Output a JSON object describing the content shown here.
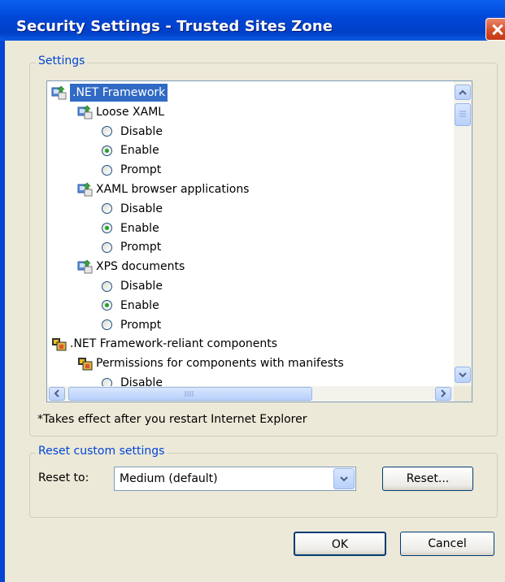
{
  "window": {
    "title": "Security Settings - Trusted Sites Zone"
  },
  "settings": {
    "legend": "Settings",
    "items": [
      {
        "label": ".NET Framework",
        "kind": "category",
        "selected": true
      },
      {
        "label": "Loose XAML",
        "kind": "group"
      },
      {
        "label": "Disable",
        "kind": "option",
        "checked": false
      },
      {
        "label": "Enable",
        "kind": "option",
        "checked": true
      },
      {
        "label": "Prompt",
        "kind": "option",
        "checked": false
      },
      {
        "label": "XAML browser applications",
        "kind": "group"
      },
      {
        "label": "Disable",
        "kind": "option",
        "checked": false
      },
      {
        "label": "Enable",
        "kind": "option",
        "checked": true
      },
      {
        "label": "Prompt",
        "kind": "option",
        "checked": false
      },
      {
        "label": "XPS documents",
        "kind": "group"
      },
      {
        "label": "Disable",
        "kind": "option",
        "checked": false
      },
      {
        "label": "Enable",
        "kind": "option",
        "checked": true
      },
      {
        "label": "Prompt",
        "kind": "option",
        "checked": false
      },
      {
        "label": ".NET Framework-reliant components",
        "kind": "category2"
      },
      {
        "label": "Permissions for components with manifests",
        "kind": "group2"
      },
      {
        "label": "Disable",
        "kind": "option",
        "checked": false
      }
    ],
    "note": "*Takes effect after you restart Internet Explorer"
  },
  "reset": {
    "legend": "Reset custom settings",
    "label": "Reset to:",
    "value": "Medium (default)",
    "button": "Reset..."
  },
  "buttons": {
    "ok": "OK",
    "cancel": "Cancel"
  },
  "icons": {
    "close": "close-icon",
    "net": "dotnet-settings-icon",
    "components": "components-icon",
    "radio": "radio-button"
  }
}
